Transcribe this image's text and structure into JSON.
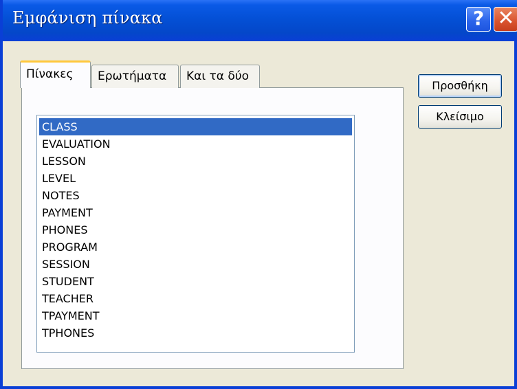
{
  "window": {
    "title": "Εμφάνιση πίνακα",
    "help_label": "?",
    "close_label": "✕"
  },
  "tabs": [
    {
      "label": "Πίνακες",
      "active": true
    },
    {
      "label": "Ερωτήματα",
      "active": false
    },
    {
      "label": "Και τα δύο",
      "active": false
    }
  ],
  "list": {
    "selected": "CLASS",
    "items": [
      "CLASS",
      "EVALUATION",
      "LESSON",
      "LEVEL",
      "NOTES",
      "PAYMENT",
      "PHONES",
      "PROGRAM",
      "SESSION",
      "STUDENT",
      "TEACHER",
      "TPAYMENT",
      "TPHONES"
    ]
  },
  "buttons": {
    "add_label": "Προσθήκη",
    "close_label": "Κλείσιμο"
  },
  "colors": {
    "titlebar": "#0450d6",
    "selection": "#316ac5",
    "tab_accent": "#ffc83c"
  }
}
